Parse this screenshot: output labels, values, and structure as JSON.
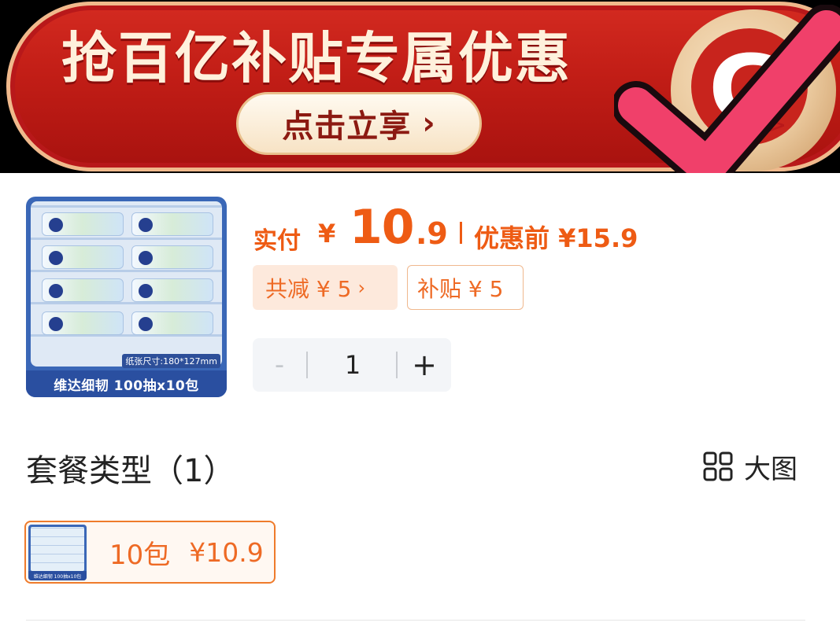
{
  "banner": {
    "title": "抢百亿补贴专属优惠",
    "cta_label": "点击立享",
    "cta_chevron": "›",
    "coin_glyph": "G",
    "coin_arrow": ">",
    "icon_names": [
      "chevron-right-icon",
      "coin-badge-icon",
      "checkmark-icon"
    ],
    "colors": {
      "banner_red": "#c11d16",
      "checkmark_pink": "#f0406a",
      "cta_text": "#8c1a12"
    }
  },
  "product": {
    "thumbnail_caption": "维达细韧 100抽x10包",
    "thumbnail_size_tag": "纸张尺寸:180*127mm",
    "pay_label": "实付",
    "currency": "¥",
    "pay_amount_int": "10",
    "pay_amount_dec": ".9",
    "original_price_label": "优惠前 ¥15.9",
    "discount_tag": "共减 ¥ 5",
    "discount_chevron": "›",
    "subsidy_tag": "补贴 ¥ 5",
    "accent_color": "#ee5b14"
  },
  "quantity": {
    "minus_label": "-",
    "value": "1",
    "plus_label": "+"
  },
  "package": {
    "section_title": "套餐类型（1）",
    "big_view_label": "大图",
    "options": [
      {
        "name": "10包",
        "price": "¥10.9",
        "selected": true,
        "thumb_caption": "维达细韧 100抽x10包"
      }
    ]
  }
}
